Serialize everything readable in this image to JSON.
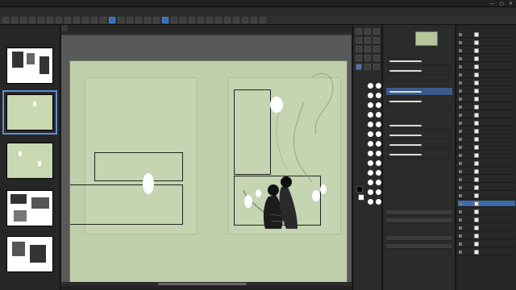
{
  "window": {
    "title": "",
    "controls": [
      "—",
      "▢",
      "✕"
    ]
  },
  "menu": {
    "items": [
      "",
      "",
      "",
      "",
      "",
      "",
      "",
      "",
      "",
      "",
      "",
      ""
    ]
  },
  "document_tab": {
    "label": ""
  },
  "pages": [
    {
      "label_left": "",
      "label_right": "",
      "style": "ink"
    },
    {
      "label_left": "",
      "label_right": "",
      "style": "green",
      "selected": true
    },
    {
      "label_left": "",
      "label_right": "",
      "style": "green"
    },
    {
      "label_left": "",
      "label_right": "",
      "style": "ink"
    },
    {
      "label_left": "",
      "label_right": "",
      "style": "ink"
    }
  ],
  "brushes": [
    {
      "name": ""
    },
    {
      "name": ""
    },
    {
      "name": ""
    },
    {
      "name": ""
    },
    {
      "name": ""
    },
    {
      "name": ""
    },
    {
      "name": ""
    },
    {
      "name": ""
    }
  ],
  "layers": [
    {
      "name": ""
    },
    {
      "name": ""
    },
    {
      "name": ""
    },
    {
      "name": ""
    },
    {
      "name": ""
    },
    {
      "name": ""
    },
    {
      "name": ""
    },
    {
      "name": ""
    },
    {
      "name": ""
    },
    {
      "name": ""
    },
    {
      "name": ""
    },
    {
      "name": ""
    },
    {
      "name": ""
    },
    {
      "name": ""
    },
    {
      "name": ""
    },
    {
      "name": ""
    },
    {
      "name": ""
    },
    {
      "name": ""
    },
    {
      "name": ""
    },
    {
      "name": ""
    },
    {
      "name": ""
    },
    {
      "name": ""
    },
    {
      "name": ""
    },
    {
      "name": ""
    },
    {
      "name": ""
    },
    {
      "name": ""
    },
    {
      "name": ""
    },
    {
      "name": ""
    }
  ],
  "colors": {
    "accent": "#3d6aa8",
    "canvas_bg": "#595959",
    "page_tint": "#bfcfaa",
    "panel_bg": "#2a2a2a"
  },
  "icons": [
    "close-icon",
    "minimize-icon",
    "maximize-icon",
    "eye-icon",
    "pen-tool-icon",
    "brush-tool-icon",
    "eraser-tool-icon",
    "fill-tool-icon",
    "move-tool-icon",
    "zoom-tool-icon"
  ]
}
